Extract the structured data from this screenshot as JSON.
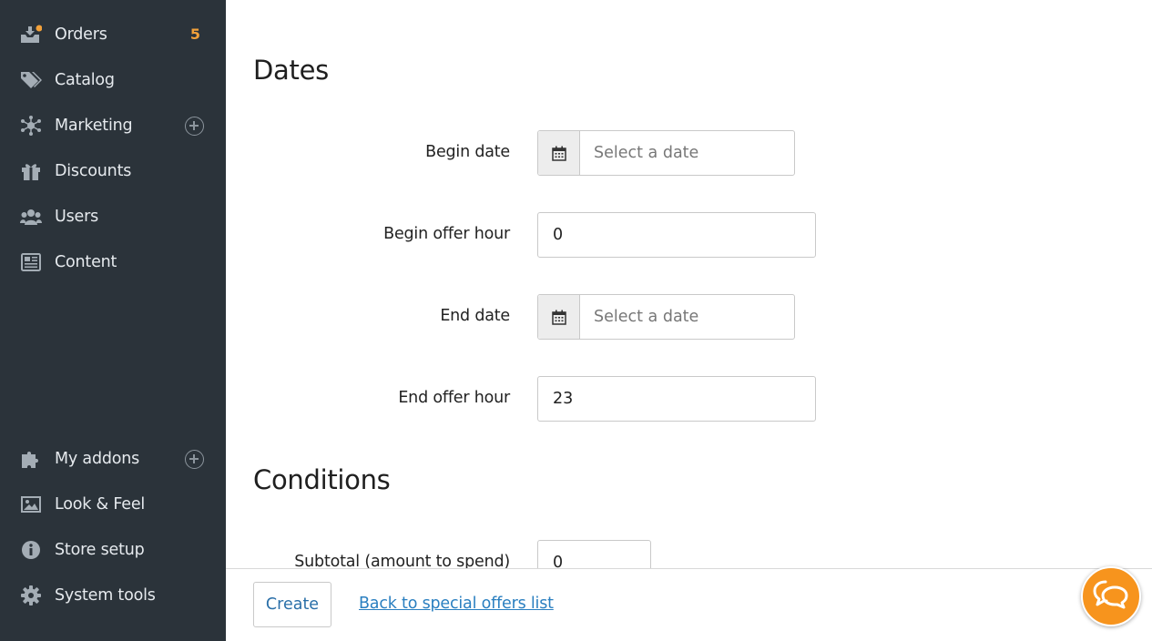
{
  "sidebar": {
    "items": [
      {
        "label": "Orders",
        "icon": "orders-icon",
        "badge": "5"
      },
      {
        "label": "Catalog",
        "icon": "tags-icon"
      },
      {
        "label": "Marketing",
        "icon": "marketing-icon"
      },
      {
        "label": "Discounts",
        "icon": "gift-icon"
      },
      {
        "label": "Users",
        "icon": "users-icon"
      },
      {
        "label": "Content",
        "icon": "newspaper-icon"
      },
      {
        "label": "My addons",
        "icon": "puzzle-icon"
      },
      {
        "label": "Look & Feel",
        "icon": "image-icon"
      },
      {
        "label": "Store setup",
        "icon": "info-icon"
      },
      {
        "label": "System tools",
        "icon": "gear-icon"
      }
    ]
  },
  "dates_section": {
    "title": "Dates",
    "begin_date": {
      "label": "Begin date",
      "placeholder": "Select a date"
    },
    "begin_offer_hour": {
      "label": "Begin offer hour",
      "value": "0"
    },
    "end_date": {
      "label": "End date",
      "placeholder": "Select a date"
    },
    "end_offer_hour": {
      "label": "End offer hour",
      "value": "23"
    }
  },
  "conditions_section": {
    "title": "Conditions",
    "subtotal": {
      "label": "Subtotal (amount to spend)",
      "value": "0"
    }
  },
  "footer": {
    "create_label": "Create",
    "back_link": "Back to special offers list"
  },
  "colors": {
    "sidebar_bg": "#2b333a",
    "accent_orange": "#f7941d",
    "link_blue": "#2a7fc0"
  }
}
